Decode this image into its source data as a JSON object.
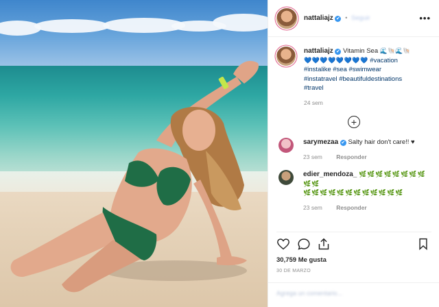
{
  "post": {
    "username": "nattaliajz",
    "verified_mark": "✔",
    "header_separator": "•",
    "header_follow": "Seguir",
    "more_icon": "•••"
  },
  "caption": {
    "username": "nattaliajz",
    "text_start": "Vitamin Sea",
    "wave_emojis": "🌊🐚🌊🐚",
    "heart_emojis": "💙💙💙💙💙💙💙💙",
    "hashtags_line1": "#vacation",
    "hashtags_line2": "#instalike #sea #swimwear",
    "hashtags_line3": "#instatravel #beautifuldestinations",
    "hashtags_line4": "#travel",
    "time": "24 sem"
  },
  "load_more_icon": "+",
  "comments": [
    {
      "username": "sarymezaa",
      "text": "Salty hair don't care!! ♥",
      "time": "23 sem",
      "reply": "Responder"
    },
    {
      "username": "edier_mendoza_",
      "text_line1": "🌿🌿🌿🌿🌿🌿🌿🌿🌿🌿",
      "text_line2": "🌿🌿🌿🌿🌿🌿🌿🌿🌿🌿🌿🌿",
      "time": "23 sem",
      "reply": "Responder"
    }
  ],
  "likes": {
    "count": "30,759",
    "label": "Me gusta"
  },
  "date": "30 DE MARZO",
  "add_comment_placeholder": "Agrega un comentario...",
  "colors": {
    "link": "#003569",
    "verified": "#3897f0",
    "hashtag": "#003569"
  }
}
